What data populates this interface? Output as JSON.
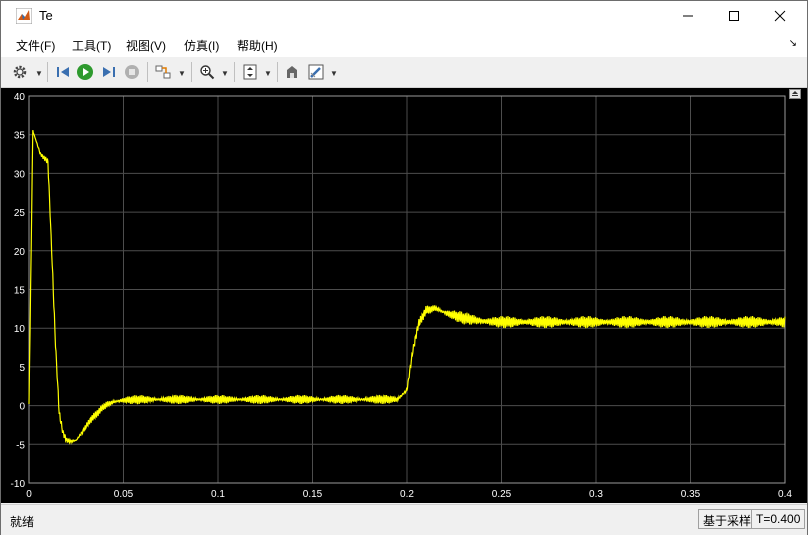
{
  "window": {
    "title": "Te",
    "minimize_glyph": "—",
    "maximize_glyph": "☐",
    "close_glyph": "✕"
  },
  "menu": {
    "items": [
      "文件(F)",
      "工具(T)",
      "视图(V)",
      "仿真(I)",
      "帮助(H)"
    ],
    "overflow_glyph": "↘"
  },
  "toolbar": {
    "icons": [
      "gear-icon",
      "step-back-icon",
      "run-icon",
      "step-forward-icon",
      "stop-icon",
      "signal-select-icon",
      "zoom-icon",
      "autoscale-icon",
      "highlight-block-icon",
      "style-icon"
    ]
  },
  "status": {
    "left": "就绪",
    "mode": "基于采样",
    "time": "T=0.400"
  },
  "colors": {
    "plot_bg": "#000000",
    "grid": "#4d4d4d",
    "axis_text": "#ffffff",
    "trace": "#ffff00"
  },
  "chart_data": {
    "type": "line",
    "title": "",
    "xlabel": "",
    "ylabel": "",
    "xlim": [
      0,
      0.4
    ],
    "ylim": [
      -10,
      40
    ],
    "xticks": [
      0,
      0.05,
      0.1,
      0.15,
      0.2,
      0.25,
      0.3,
      0.35,
      0.4
    ],
    "xtick_labels": [
      "0",
      "0.05",
      "0.1",
      "0.15",
      "0.2",
      "0.25",
      "0.3",
      "0.35",
      "0.4"
    ],
    "yticks": [
      -10,
      -5,
      0,
      5,
      10,
      15,
      20,
      25,
      30,
      35,
      40
    ],
    "ytick_labels": [
      "-10",
      "-5",
      "0",
      "5",
      "10",
      "15",
      "20",
      "25",
      "30",
      "35",
      "40"
    ],
    "grid": true,
    "series": [
      {
        "color": "#ffff00",
        "x": [
          0,
          0.002,
          0.004,
          0.006,
          0.008,
          0.01,
          0.012,
          0.014,
          0.016,
          0.018,
          0.02,
          0.022,
          0.025,
          0.028,
          0.032,
          0.036,
          0.04,
          0.045,
          0.05,
          0.06,
          0.08,
          0.1,
          0.12,
          0.14,
          0.16,
          0.18,
          0.195,
          0.2,
          0.203,
          0.206,
          0.21,
          0.215,
          0.22,
          0.23,
          0.24,
          0.25,
          0.3,
          0.35,
          0.4
        ],
        "y": [
          0,
          35.5,
          34.0,
          32.5,
          32.0,
          31.5,
          20.0,
          8.0,
          -1.0,
          -3.5,
          -4.5,
          -4.6,
          -4.5,
          -3.5,
          -2.0,
          -1.0,
          0.0,
          0.5,
          0.7,
          0.8,
          0.8,
          0.8,
          0.8,
          0.8,
          0.8,
          0.8,
          0.8,
          2.0,
          7.0,
          10.5,
          12.3,
          12.6,
          12.0,
          11.3,
          10.9,
          10.8,
          10.8,
          10.8,
          10.8
        ]
      }
    ]
  }
}
